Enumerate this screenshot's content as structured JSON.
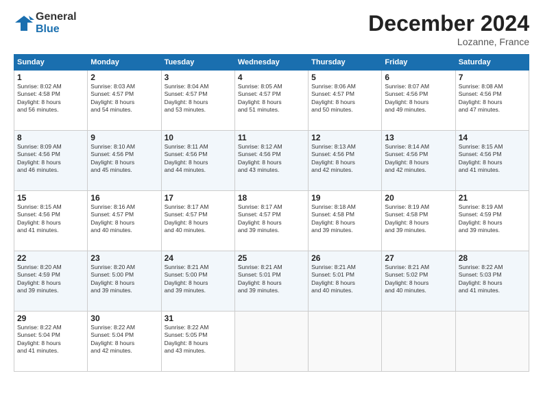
{
  "header": {
    "logo_general": "General",
    "logo_blue": "Blue",
    "month_title": "December 2024",
    "location": "Lozanne, France"
  },
  "weekdays": [
    "Sunday",
    "Monday",
    "Tuesday",
    "Wednesday",
    "Thursday",
    "Friday",
    "Saturday"
  ],
  "weeks": [
    [
      {
        "day": "1",
        "lines": [
          "Sunrise: 8:02 AM",
          "Sunset: 4:58 PM",
          "Daylight: 8 hours",
          "and 56 minutes."
        ]
      },
      {
        "day": "2",
        "lines": [
          "Sunrise: 8:03 AM",
          "Sunset: 4:57 PM",
          "Daylight: 8 hours",
          "and 54 minutes."
        ]
      },
      {
        "day": "3",
        "lines": [
          "Sunrise: 8:04 AM",
          "Sunset: 4:57 PM",
          "Daylight: 8 hours",
          "and 53 minutes."
        ]
      },
      {
        "day": "4",
        "lines": [
          "Sunrise: 8:05 AM",
          "Sunset: 4:57 PM",
          "Daylight: 8 hours",
          "and 51 minutes."
        ]
      },
      {
        "day": "5",
        "lines": [
          "Sunrise: 8:06 AM",
          "Sunset: 4:57 PM",
          "Daylight: 8 hours",
          "and 50 minutes."
        ]
      },
      {
        "day": "6",
        "lines": [
          "Sunrise: 8:07 AM",
          "Sunset: 4:56 PM",
          "Daylight: 8 hours",
          "and 49 minutes."
        ]
      },
      {
        "day": "7",
        "lines": [
          "Sunrise: 8:08 AM",
          "Sunset: 4:56 PM",
          "Daylight: 8 hours",
          "and 47 minutes."
        ]
      }
    ],
    [
      {
        "day": "8",
        "lines": [
          "Sunrise: 8:09 AM",
          "Sunset: 4:56 PM",
          "Daylight: 8 hours",
          "and 46 minutes."
        ]
      },
      {
        "day": "9",
        "lines": [
          "Sunrise: 8:10 AM",
          "Sunset: 4:56 PM",
          "Daylight: 8 hours",
          "and 45 minutes."
        ]
      },
      {
        "day": "10",
        "lines": [
          "Sunrise: 8:11 AM",
          "Sunset: 4:56 PM",
          "Daylight: 8 hours",
          "and 44 minutes."
        ]
      },
      {
        "day": "11",
        "lines": [
          "Sunrise: 8:12 AM",
          "Sunset: 4:56 PM",
          "Daylight: 8 hours",
          "and 43 minutes."
        ]
      },
      {
        "day": "12",
        "lines": [
          "Sunrise: 8:13 AM",
          "Sunset: 4:56 PM",
          "Daylight: 8 hours",
          "and 42 minutes."
        ]
      },
      {
        "day": "13",
        "lines": [
          "Sunrise: 8:14 AM",
          "Sunset: 4:56 PM",
          "Daylight: 8 hours",
          "and 42 minutes."
        ]
      },
      {
        "day": "14",
        "lines": [
          "Sunrise: 8:15 AM",
          "Sunset: 4:56 PM",
          "Daylight: 8 hours",
          "and 41 minutes."
        ]
      }
    ],
    [
      {
        "day": "15",
        "lines": [
          "Sunrise: 8:15 AM",
          "Sunset: 4:56 PM",
          "Daylight: 8 hours",
          "and 41 minutes."
        ]
      },
      {
        "day": "16",
        "lines": [
          "Sunrise: 8:16 AM",
          "Sunset: 4:57 PM",
          "Daylight: 8 hours",
          "and 40 minutes."
        ]
      },
      {
        "day": "17",
        "lines": [
          "Sunrise: 8:17 AM",
          "Sunset: 4:57 PM",
          "Daylight: 8 hours",
          "and 40 minutes."
        ]
      },
      {
        "day": "18",
        "lines": [
          "Sunrise: 8:17 AM",
          "Sunset: 4:57 PM",
          "Daylight: 8 hours",
          "and 39 minutes."
        ]
      },
      {
        "day": "19",
        "lines": [
          "Sunrise: 8:18 AM",
          "Sunset: 4:58 PM",
          "Daylight: 8 hours",
          "and 39 minutes."
        ]
      },
      {
        "day": "20",
        "lines": [
          "Sunrise: 8:19 AM",
          "Sunset: 4:58 PM",
          "Daylight: 8 hours",
          "and 39 minutes."
        ]
      },
      {
        "day": "21",
        "lines": [
          "Sunrise: 8:19 AM",
          "Sunset: 4:59 PM",
          "Daylight: 8 hours",
          "and 39 minutes."
        ]
      }
    ],
    [
      {
        "day": "22",
        "lines": [
          "Sunrise: 8:20 AM",
          "Sunset: 4:59 PM",
          "Daylight: 8 hours",
          "and 39 minutes."
        ]
      },
      {
        "day": "23",
        "lines": [
          "Sunrise: 8:20 AM",
          "Sunset: 5:00 PM",
          "Daylight: 8 hours",
          "and 39 minutes."
        ]
      },
      {
        "day": "24",
        "lines": [
          "Sunrise: 8:21 AM",
          "Sunset: 5:00 PM",
          "Daylight: 8 hours",
          "and 39 minutes."
        ]
      },
      {
        "day": "25",
        "lines": [
          "Sunrise: 8:21 AM",
          "Sunset: 5:01 PM",
          "Daylight: 8 hours",
          "and 39 minutes."
        ]
      },
      {
        "day": "26",
        "lines": [
          "Sunrise: 8:21 AM",
          "Sunset: 5:01 PM",
          "Daylight: 8 hours",
          "and 40 minutes."
        ]
      },
      {
        "day": "27",
        "lines": [
          "Sunrise: 8:21 AM",
          "Sunset: 5:02 PM",
          "Daylight: 8 hours",
          "and 40 minutes."
        ]
      },
      {
        "day": "28",
        "lines": [
          "Sunrise: 8:22 AM",
          "Sunset: 5:03 PM",
          "Daylight: 8 hours",
          "and 41 minutes."
        ]
      }
    ],
    [
      {
        "day": "29",
        "lines": [
          "Sunrise: 8:22 AM",
          "Sunset: 5:04 PM",
          "Daylight: 8 hours",
          "and 41 minutes."
        ]
      },
      {
        "day": "30",
        "lines": [
          "Sunrise: 8:22 AM",
          "Sunset: 5:04 PM",
          "Daylight: 8 hours",
          "and 42 minutes."
        ]
      },
      {
        "day": "31",
        "lines": [
          "Sunrise: 8:22 AM",
          "Sunset: 5:05 PM",
          "Daylight: 8 hours",
          "and 43 minutes."
        ]
      },
      null,
      null,
      null,
      null
    ]
  ]
}
